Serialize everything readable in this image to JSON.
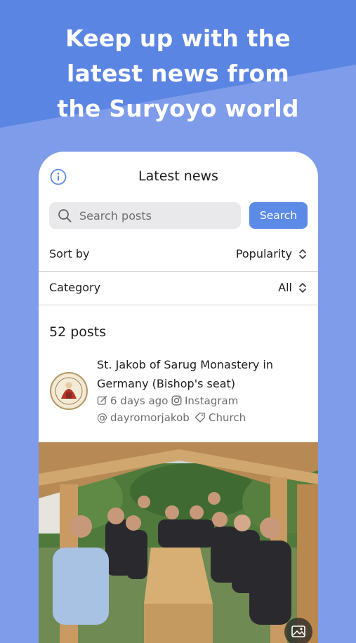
{
  "headline": {
    "line1": "Keep up with the",
    "line2": "latest news from",
    "line3": "the Suryoyo world"
  },
  "header": {
    "title": "Latest news",
    "info_icon": "info-icon"
  },
  "search": {
    "placeholder": "Search posts",
    "value": "",
    "button_label": "Search",
    "icon": "search-icon"
  },
  "filters": {
    "sort_label": "Sort by",
    "sort_value": "Popularity",
    "category_label": "Category",
    "category_value": "All",
    "chevron_icon": "chevron-up-down-icon"
  },
  "posts": {
    "count_text": "52 posts",
    "items": [
      {
        "title": "St. Jakob of Sarug Monastery in Germany (Bishop's seat)",
        "time": "6 days ago",
        "source": "Instagram",
        "account": "dayromorjakob",
        "tag": "Church",
        "image_icon": "image-icon"
      }
    ]
  },
  "colors": {
    "background": "#7e9cea",
    "background_band": "#5b85e2",
    "accent": "#5b8be6",
    "card": "#ffffff"
  }
}
